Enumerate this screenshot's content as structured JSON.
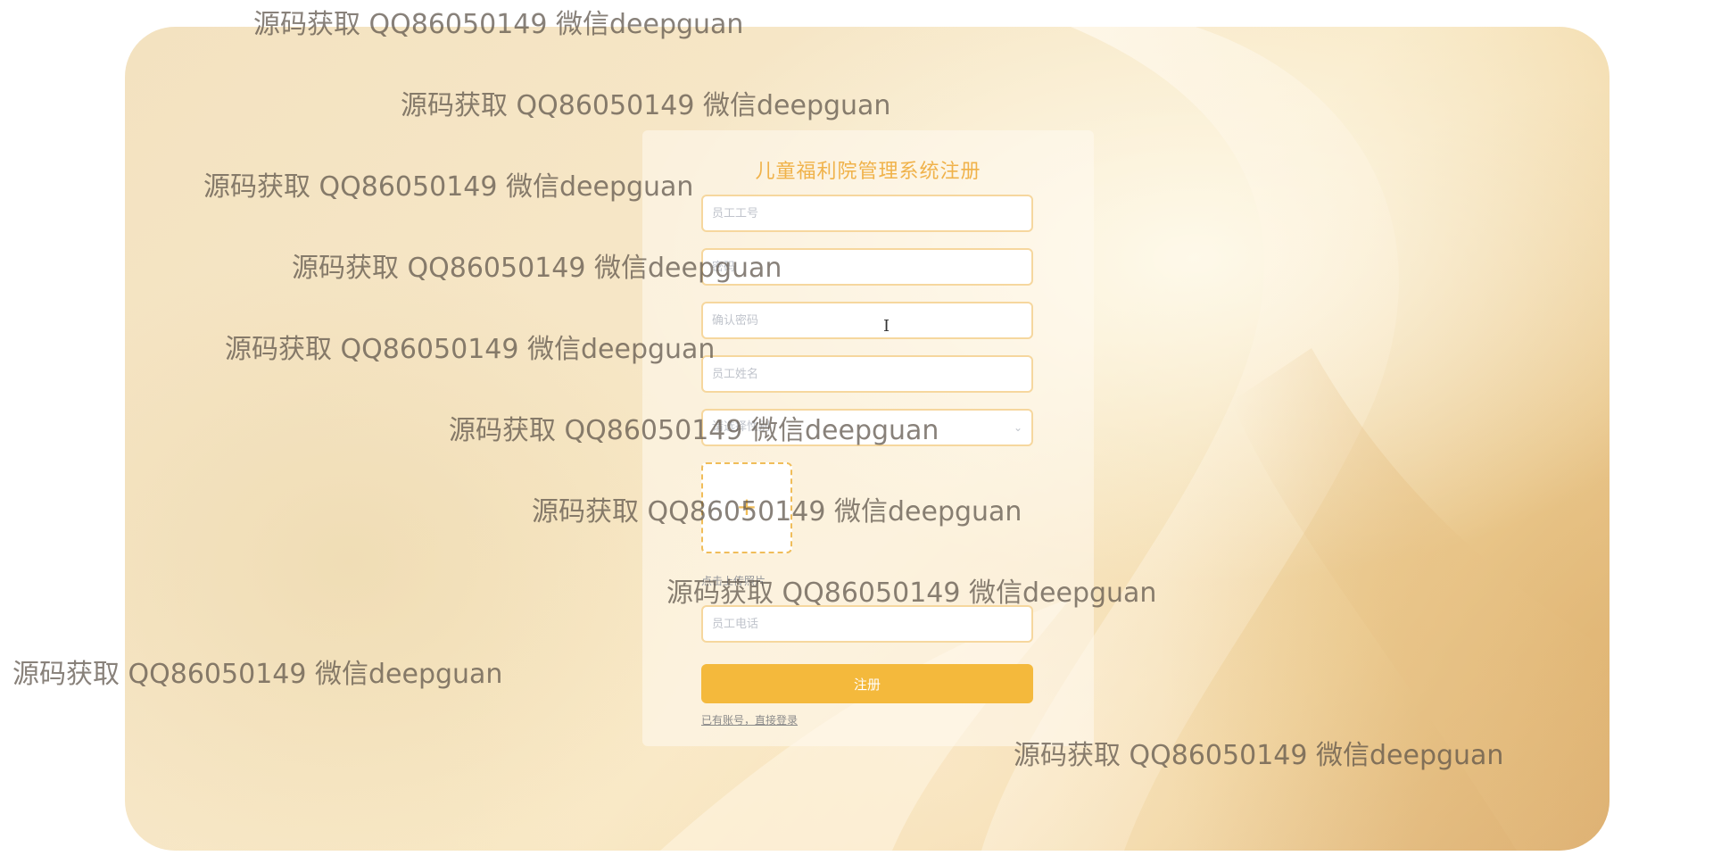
{
  "form": {
    "title": "儿童福利院管理系统注册",
    "employee_id_placeholder": "员工工号",
    "password_placeholder": "密码",
    "confirm_password_placeholder": "确认密码",
    "employee_name_placeholder": "员工姓名",
    "gender_placeholder": "请选择性别",
    "upload_hint": "点击上传照片",
    "phone_placeholder": "员工电话",
    "register_button": "注册",
    "login_link": "已有账号，直接登录"
  },
  "watermarks": [
    "源码获取 QQ86050149 微信deepguan",
    "源码获取 QQ86050149 微信deepguan",
    "源码获取 QQ86050149 微信deepguan",
    "源码获取 QQ86050149 微信deepguan",
    "源码获取 QQ86050149 微信deepguan",
    "源码获取 QQ86050149 微信deepguan",
    "源码获取 QQ86050149 微信deepguan",
    "源码获取 QQ86050149 微信deepguan",
    "源码获取 QQ86050149 微信deepguan",
    "源码获取 QQ86050149 微信deepguan"
  ],
  "colors": {
    "accent": "#f4b93c",
    "title": "#f0b24a",
    "field_border": "#f6d79e",
    "watermark": "#5a5046"
  },
  "icons": {
    "select_arrow": "chevron-down-icon",
    "upload": "plus-icon",
    "cursor": "text-cursor-icon"
  }
}
